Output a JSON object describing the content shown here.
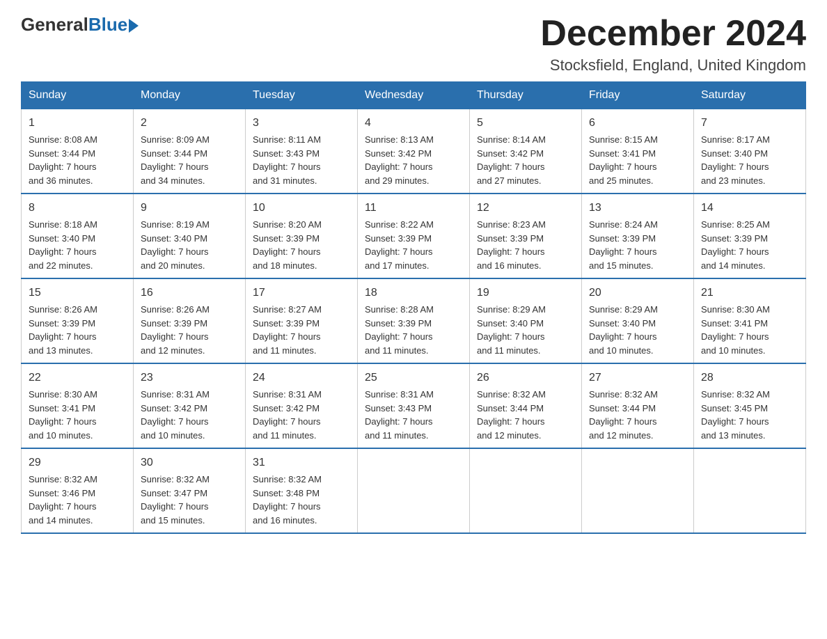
{
  "logo": {
    "general": "General",
    "blue": "Blue"
  },
  "header": {
    "title": "December 2024",
    "location": "Stocksfield, England, United Kingdom"
  },
  "weekdays": [
    "Sunday",
    "Monday",
    "Tuesday",
    "Wednesday",
    "Thursday",
    "Friday",
    "Saturday"
  ],
  "weeks": [
    [
      {
        "day": "1",
        "sunrise": "8:08 AM",
        "sunset": "3:44 PM",
        "daylight": "7 hours and 36 minutes."
      },
      {
        "day": "2",
        "sunrise": "8:09 AM",
        "sunset": "3:44 PM",
        "daylight": "7 hours and 34 minutes."
      },
      {
        "day": "3",
        "sunrise": "8:11 AM",
        "sunset": "3:43 PM",
        "daylight": "7 hours and 31 minutes."
      },
      {
        "day": "4",
        "sunrise": "8:13 AM",
        "sunset": "3:42 PM",
        "daylight": "7 hours and 29 minutes."
      },
      {
        "day": "5",
        "sunrise": "8:14 AM",
        "sunset": "3:42 PM",
        "daylight": "7 hours and 27 minutes."
      },
      {
        "day": "6",
        "sunrise": "8:15 AM",
        "sunset": "3:41 PM",
        "daylight": "7 hours and 25 minutes."
      },
      {
        "day": "7",
        "sunrise": "8:17 AM",
        "sunset": "3:40 PM",
        "daylight": "7 hours and 23 minutes."
      }
    ],
    [
      {
        "day": "8",
        "sunrise": "8:18 AM",
        "sunset": "3:40 PM",
        "daylight": "7 hours and 22 minutes."
      },
      {
        "day": "9",
        "sunrise": "8:19 AM",
        "sunset": "3:40 PM",
        "daylight": "7 hours and 20 minutes."
      },
      {
        "day": "10",
        "sunrise": "8:20 AM",
        "sunset": "3:39 PM",
        "daylight": "7 hours and 18 minutes."
      },
      {
        "day": "11",
        "sunrise": "8:22 AM",
        "sunset": "3:39 PM",
        "daylight": "7 hours and 17 minutes."
      },
      {
        "day": "12",
        "sunrise": "8:23 AM",
        "sunset": "3:39 PM",
        "daylight": "7 hours and 16 minutes."
      },
      {
        "day": "13",
        "sunrise": "8:24 AM",
        "sunset": "3:39 PM",
        "daylight": "7 hours and 15 minutes."
      },
      {
        "day": "14",
        "sunrise": "8:25 AM",
        "sunset": "3:39 PM",
        "daylight": "7 hours and 14 minutes."
      }
    ],
    [
      {
        "day": "15",
        "sunrise": "8:26 AM",
        "sunset": "3:39 PM",
        "daylight": "7 hours and 13 minutes."
      },
      {
        "day": "16",
        "sunrise": "8:26 AM",
        "sunset": "3:39 PM",
        "daylight": "7 hours and 12 minutes."
      },
      {
        "day": "17",
        "sunrise": "8:27 AM",
        "sunset": "3:39 PM",
        "daylight": "7 hours and 11 minutes."
      },
      {
        "day": "18",
        "sunrise": "8:28 AM",
        "sunset": "3:39 PM",
        "daylight": "7 hours and 11 minutes."
      },
      {
        "day": "19",
        "sunrise": "8:29 AM",
        "sunset": "3:40 PM",
        "daylight": "7 hours and 11 minutes."
      },
      {
        "day": "20",
        "sunrise": "8:29 AM",
        "sunset": "3:40 PM",
        "daylight": "7 hours and 10 minutes."
      },
      {
        "day": "21",
        "sunrise": "8:30 AM",
        "sunset": "3:41 PM",
        "daylight": "7 hours and 10 minutes."
      }
    ],
    [
      {
        "day": "22",
        "sunrise": "8:30 AM",
        "sunset": "3:41 PM",
        "daylight": "7 hours and 10 minutes."
      },
      {
        "day": "23",
        "sunrise": "8:31 AM",
        "sunset": "3:42 PM",
        "daylight": "7 hours and 10 minutes."
      },
      {
        "day": "24",
        "sunrise": "8:31 AM",
        "sunset": "3:42 PM",
        "daylight": "7 hours and 11 minutes."
      },
      {
        "day": "25",
        "sunrise": "8:31 AM",
        "sunset": "3:43 PM",
        "daylight": "7 hours and 11 minutes."
      },
      {
        "day": "26",
        "sunrise": "8:32 AM",
        "sunset": "3:44 PM",
        "daylight": "7 hours and 12 minutes."
      },
      {
        "day": "27",
        "sunrise": "8:32 AM",
        "sunset": "3:44 PM",
        "daylight": "7 hours and 12 minutes."
      },
      {
        "day": "28",
        "sunrise": "8:32 AM",
        "sunset": "3:45 PM",
        "daylight": "7 hours and 13 minutes."
      }
    ],
    [
      {
        "day": "29",
        "sunrise": "8:32 AM",
        "sunset": "3:46 PM",
        "daylight": "7 hours and 14 minutes."
      },
      {
        "day": "30",
        "sunrise": "8:32 AM",
        "sunset": "3:47 PM",
        "daylight": "7 hours and 15 minutes."
      },
      {
        "day": "31",
        "sunrise": "8:32 AM",
        "sunset": "3:48 PM",
        "daylight": "7 hours and 16 minutes."
      },
      null,
      null,
      null,
      null
    ]
  ],
  "labels": {
    "sunrise": "Sunrise:",
    "sunset": "Sunset:",
    "daylight": "Daylight:"
  }
}
